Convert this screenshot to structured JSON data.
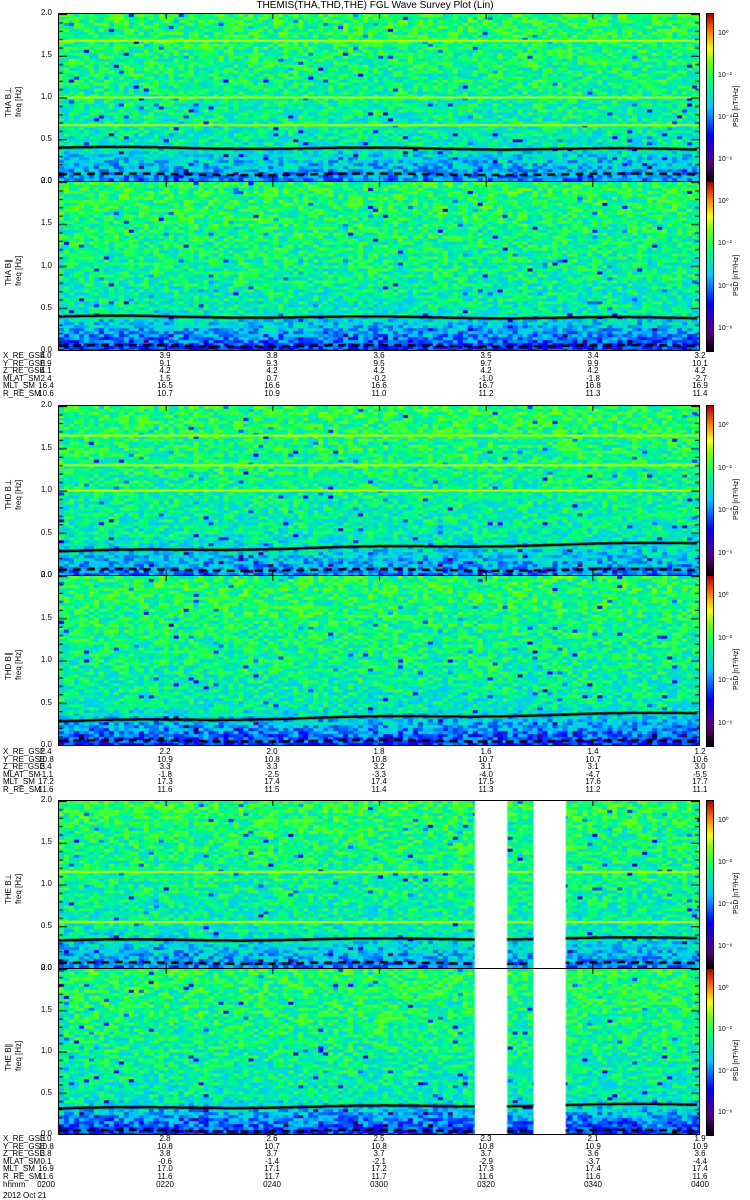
{
  "title": "THEMIS(THA,THD,THE) FGL Wave Survey Plot (Lin)",
  "date": "2012 Oct 21",
  "colorbar": {
    "unit": "PSD [nT²/Hz]",
    "ticks": [
      "10⁰",
      "10⁻²",
      "10⁻⁴",
      "10⁻⁶"
    ],
    "log_range": [
      -7,
      1
    ]
  },
  "chart_data": {
    "type": "heatmap",
    "title": "THEMIS(THA,THD,THE) FGL Wave Survey Plot (Lin)",
    "xlabel": "hhmm",
    "x_ticks": [
      "0200",
      "0220",
      "0240",
      "0300",
      "0320",
      "0340",
      "0400"
    ],
    "ylim": [
      0.0,
      2.0
    ],
    "y_ticks": [
      "0.0",
      "0.5",
      "1.0",
      "1.5",
      "2.0"
    ],
    "panels": [
      {
        "probe": "THA",
        "label": "THA B⊥",
        "ylabel": "freq [Hz]",
        "seed": 11,
        "bands": [
          1.0,
          1.68,
          0.67
        ],
        "solid": [
          0.4,
          0.38
        ],
        "dashed": [
          0.08,
          0.08
        ],
        "gaps": []
      },
      {
        "probe": "THA",
        "label": "THA B∥",
        "ylabel": "freq [Hz]",
        "seed": 12,
        "bands": [],
        "solid": [
          0.4,
          0.38
        ],
        "dashed": [
          0.05,
          0.05
        ],
        "gaps": []
      },
      {
        "probe": "THD",
        "label": "THD B⊥",
        "ylabel": "freq [Hz]",
        "seed": 21,
        "bands": [
          1.0,
          1.3,
          1.65
        ],
        "solid": [
          0.28,
          0.38
        ],
        "dashed": [
          0.06,
          0.06
        ],
        "gaps": []
      },
      {
        "probe": "THD",
        "label": "THD B∥",
        "ylabel": "freq [Hz]",
        "seed": 22,
        "bands": [],
        "solid": [
          0.28,
          0.38
        ],
        "dashed": [
          0.05,
          0.05
        ],
        "gaps": []
      },
      {
        "probe": "THE",
        "label": "THE B⊥",
        "ylabel": "freq [Hz]",
        "seed": 31,
        "bands": [
          0.55,
          1.15
        ],
        "solid": [
          0.33,
          0.36
        ],
        "dashed": [
          0.06,
          0.06
        ],
        "gaps": [
          [
            "0318",
            "0324"
          ],
          [
            "0329",
            "0335"
          ]
        ]
      },
      {
        "probe": "THE",
        "label": "THE B∥",
        "ylabel": "freq [Hz]",
        "seed": 32,
        "bands": [],
        "solid": [
          0.31,
          0.36
        ],
        "dashed": [
          0.04,
          0.04
        ],
        "gaps": [
          [
            "0318",
            "0324"
          ],
          [
            "0329",
            "0335"
          ]
        ]
      }
    ]
  },
  "ephemeris": [
    {
      "rows": [
        {
          "label": "X_RE_GSE",
          "values": [
            "4.0",
            "3.9",
            "3.8",
            "3.6",
            "3.5",
            "3.4",
            "3.2"
          ]
        },
        {
          "label": "Y_RE_GSE",
          "values": [
            "8.9",
            "9.1",
            "9.3",
            "9.5",
            "9.7",
            "9.9",
            "10.1"
          ]
        },
        {
          "label": "Z_RE_GSE",
          "values": [
            "4.1",
            "4.2",
            "4.2",
            "4.2",
            "4.2",
            "4.2",
            "4.2"
          ]
        },
        {
          "label": "MLAT_SM",
          "values": [
            "2.4",
            "1.5",
            "0.7",
            "-0.2",
            "-1.0",
            "-1.8",
            "-2.7"
          ]
        },
        {
          "label": "MLT_SM",
          "values": [
            "16.4",
            "16.5",
            "16.6",
            "16.6",
            "16.7",
            "16.8",
            "16.9"
          ]
        },
        {
          "label": "R_RE_SM",
          "values": [
            "10.6",
            "10.7",
            "10.9",
            "11.0",
            "11.2",
            "11.3",
            "11.4"
          ]
        }
      ]
    },
    {
      "rows": [
        {
          "label": "X_RE_GSE",
          "values": [
            "2.4",
            "2.2",
            "2.0",
            "1.8",
            "1.6",
            "1.4",
            "1.2"
          ]
        },
        {
          "label": "Y_RE_GSE",
          "values": [
            "10.8",
            "10.9",
            "10.8",
            "10.8",
            "10.7",
            "10.7",
            "10.6"
          ]
        },
        {
          "label": "Z_RE_GSE",
          "values": [
            "3.4",
            "3.3",
            "3.3",
            "3.2",
            "3.1",
            "3.1",
            "3.0"
          ]
        },
        {
          "label": "MLAT_SM",
          "values": [
            "-1.1",
            "-1.8",
            "-2.5",
            "-3.3",
            "-4.0",
            "-4.7",
            "-5.5"
          ]
        },
        {
          "label": "MLT_SM",
          "values": [
            "17.2",
            "17.3",
            "17.4",
            "17.4",
            "17.5",
            "17.6",
            "17.7"
          ]
        },
        {
          "label": "R_RE_SM",
          "values": [
            "11.6",
            "11.6",
            "11.5",
            "11.4",
            "11.3",
            "11.2",
            "11.1"
          ]
        }
      ]
    },
    {
      "rows": [
        {
          "label": "X_RE_GSE",
          "values": [
            "3.0",
            "2.8",
            "2.6",
            "2.5",
            "2.3",
            "2.1",
            "1.9"
          ]
        },
        {
          "label": "Y_RE_GSE",
          "values": [
            "10.8",
            "10.8",
            "10.7",
            "10.8",
            "10.8",
            "10.9",
            "10.9"
          ]
        },
        {
          "label": "Z_RE_GSE",
          "values": [
            "3.8",
            "3.8",
            "3.7",
            "3.7",
            "3.7",
            "3.6",
            "3.6"
          ]
        },
        {
          "label": "MLAT_SM",
          "values": [
            "0.1",
            "-0.6",
            "-1.4",
            "-2.1",
            "-2.9",
            "-3.7",
            "-4.4"
          ]
        },
        {
          "label": "MLT_SM",
          "values": [
            "16.9",
            "17.0",
            "17.1",
            "17.2",
            "17.3",
            "17.4",
            "17.4"
          ]
        },
        {
          "label": "R_RE_SM",
          "values": [
            "11.6",
            "11.6",
            "11.7",
            "11.7",
            "11.6",
            "11.6",
            "11.6"
          ]
        },
        {
          "label": "hhmm",
          "values": [
            "0200",
            "0220",
            "0240",
            "0300",
            "0320",
            "0340",
            "0400"
          ]
        }
      ]
    }
  ]
}
